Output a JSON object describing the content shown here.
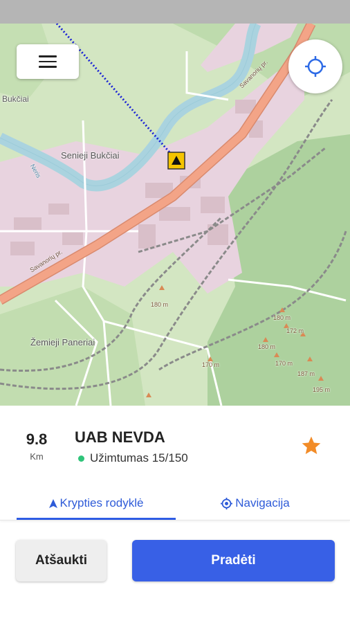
{
  "map": {
    "labels": {
      "bukciai": "Bukčiai",
      "senieji_bukciai": "Senieji Bukčiai",
      "zemieji_paneriai": "Žemieji Paneriai",
      "river": "Neris",
      "street_top": "Savanorių pr.",
      "street_bottom": "Savanorių pr.",
      "elev_1": "180 m",
      "elev_2": "180 m",
      "elev_3": "172 m",
      "elev_4": "180 m",
      "elev_5": "170 m",
      "elev_6": "170 m",
      "elev_7": "187 m",
      "elev_8": "195 m"
    },
    "colors": {
      "water": "#aad3df",
      "forest": "#add19e",
      "residential": "#e6cfdd",
      "primary_road": "#f3a487",
      "route": "#1a22d6",
      "marker": "#f5c400"
    }
  },
  "header": {
    "menu_icon": "hamburger-menu-icon",
    "locate_icon": "crosshair-location-icon"
  },
  "destination": {
    "distance": "9.8",
    "distance_unit": "Km",
    "name": "UAB NEVDA",
    "occupancy": "Užimtumas 15/150",
    "occupancy_color": "#2fc47a",
    "favorite_icon": "star-icon",
    "favorite_color": "#f28c28"
  },
  "tabs": [
    {
      "label": "Krypties rodyklė",
      "icon": "arrow-up-icon",
      "active": true
    },
    {
      "label": "Navigacija",
      "icon": "navigation-target-icon",
      "active": false
    }
  ],
  "actions": {
    "cancel_label": "Atšaukti",
    "start_label": "Pradėti",
    "start_color": "#3860e6"
  }
}
